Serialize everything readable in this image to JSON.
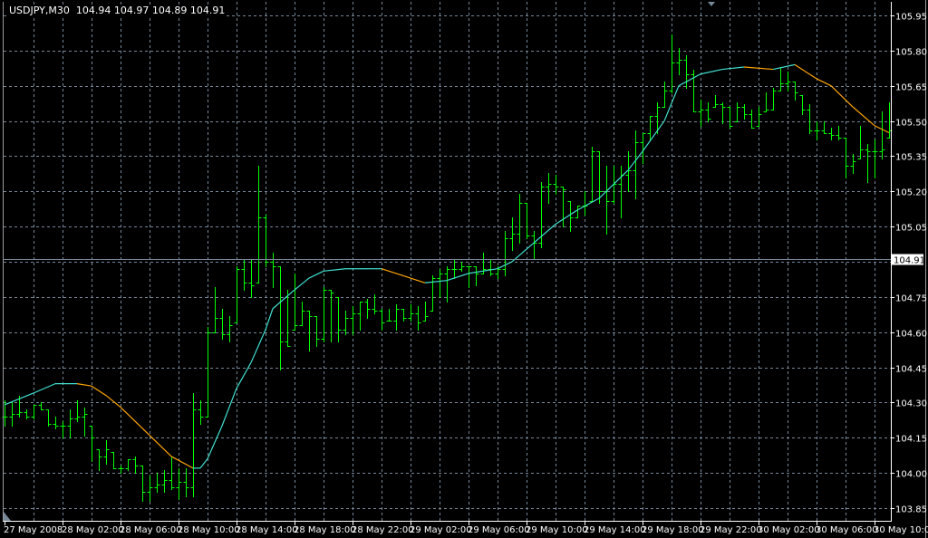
{
  "header": {
    "symbol": "USDJPY,M30",
    "open": "104.94",
    "high": "104.97",
    "low": "104.89",
    "close": "104.91"
  },
  "colors": {
    "background": "#000000",
    "grid": "#778899",
    "bars": "#00FF00",
    "ma_up": "#40E0D0",
    "ma_down": "#FFA500",
    "axis": "#FFFFFF",
    "bid_line": "#778899"
  },
  "chart_data": {
    "type": "ohlc",
    "symbol": "USDJPY",
    "timeframe": "M30",
    "ylim": [
      103.82,
      105.99
    ],
    "grid": true,
    "current_price": "104.91",
    "price_ticks": [
      "105.95",
      "105.80",
      "105.65",
      "105.50",
      "105.35",
      "105.20",
      "105.05",
      "104.90",
      "104.75",
      "104.60",
      "104.45",
      "104.30",
      "104.15",
      "104.00",
      "103.85"
    ],
    "price_tick_labels": [
      "105.95",
      "105.80",
      "105.65",
      "105.50",
      "105.35",
      "105.20",
      "105.05",
      "",
      "104.75",
      "104.60",
      "104.45",
      "104.30",
      "104.15",
      "104.00",
      "103.85"
    ],
    "time_labels": [
      {
        "bar": 0,
        "label": "27 May 2008"
      },
      {
        "bar": 8,
        "label": "28 May 02:00"
      },
      {
        "bar": 16,
        "label": "28 May 06:00"
      },
      {
        "bar": 24,
        "label": "28 May 10:00"
      },
      {
        "bar": 32,
        "label": "28 May 14:00"
      },
      {
        "bar": 40,
        "label": "28 May 18:00"
      },
      {
        "bar": 48,
        "label": "28 May 22:00"
      },
      {
        "bar": 56,
        "label": "29 May 02:00"
      },
      {
        "bar": 64,
        "label": "29 May 06:00"
      },
      {
        "bar": 72,
        "label": "29 May 10:00"
      },
      {
        "bar": 80,
        "label": "29 May 14:00"
      },
      {
        "bar": 88,
        "label": "29 May 18:00"
      },
      {
        "bar": 96,
        "label": "29 May 22:00"
      },
      {
        "bar": 104,
        "label": "30 May 02:00"
      },
      {
        "bar": 112,
        "label": "30 May 06:00"
      },
      {
        "bar": 120,
        "label": "30 May 10:00"
      }
    ],
    "high": [
      104.31,
      104.3,
      104.33,
      104.27,
      104.29,
      104.3,
      104.27,
      104.24,
      104.22,
      104.27,
      104.31,
      104.28,
      104.2,
      104.1,
      104.14,
      104.09,
      104.03,
      104.06,
      104.07,
      104.03,
      103.99,
      104.0,
      104.01,
      104.07,
      104.02,
      104.02,
      104.34,
      104.31,
      104.62,
      104.79,
      104.7,
      104.67,
      104.88,
      104.91,
      104.91,
      105.31,
      105.1,
      104.94,
      104.88,
      104.78,
      104.85,
      104.73,
      104.69,
      104.67,
      104.79,
      104.78,
      104.75,
      104.69,
      104.71,
      104.73,
      104.74,
      104.76,
      104.7,
      104.7,
      104.72,
      104.7,
      104.72,
      104.71,
      104.73,
      104.84,
      104.87,
      104.88,
      104.91,
      104.9,
      104.88,
      104.88,
      104.94,
      104.91,
      104.88,
      105.03,
      105.09,
      105.19,
      105.15,
      105.03,
      105.24,
      105.28,
      105.27,
      105.22,
      105.16,
      105.14,
      105.2,
      105.39,
      105.37,
      105.31,
      105.31,
      105.31,
      105.37,
      105.46,
      105.45,
      105.52,
      105.58,
      105.67,
      105.87,
      105.81,
      105.78,
      105.72,
      105.59,
      105.58,
      105.61,
      105.58,
      105.56,
      105.58,
      105.57,
      105.55,
      105.56,
      105.62,
      105.64,
      105.73,
      105.71,
      105.67,
      105.61,
      105.57,
      105.5,
      105.5,
      105.47,
      105.48,
      105.43,
      105.36,
      105.48,
      105.4,
      105.42,
      105.54,
      105.58
    ],
    "low": [
      104.2,
      104.2,
      104.24,
      104.23,
      104.23,
      104.27,
      104.2,
      104.19,
      104.15,
      104.15,
      104.22,
      104.16,
      104.05,
      104.01,
      104.04,
      104.02,
      104.0,
      104.01,
      104.0,
      103.88,
      103.88,
      103.92,
      103.92,
      103.93,
      103.89,
      103.9,
      103.9,
      104.21,
      104.24,
      104.6,
      104.57,
      104.56,
      104.64,
      104.78,
      104.75,
      104.81,
      104.88,
      104.79,
      104.44,
      104.54,
      104.61,
      104.63,
      104.52,
      104.54,
      104.56,
      104.56,
      104.56,
      104.59,
      104.59,
      104.61,
      104.66,
      104.68,
      104.61,
      104.65,
      104.61,
      104.65,
      104.65,
      104.61,
      104.65,
      104.69,
      104.75,
      104.73,
      104.83,
      104.86,
      104.79,
      104.8,
      104.85,
      104.84,
      104.83,
      104.84,
      104.95,
      104.98,
      105.0,
      104.91,
      104.96,
      105.15,
      105.19,
      105.05,
      105.03,
      105.09,
      105.1,
      105.16,
      105.15,
      105.02,
      105.15,
      105.09,
      105.2,
      105.17,
      105.32,
      105.42,
      105.45,
      105.56,
      105.62,
      105.7,
      105.64,
      105.54,
      105.48,
      105.5,
      105.56,
      105.49,
      105.47,
      105.5,
      105.51,
      105.47,
      105.48,
      105.54,
      105.55,
      105.63,
      105.63,
      105.59,
      105.53,
      105.45,
      105.42,
      105.45,
      105.42,
      105.42,
      105.26,
      105.28,
      105.34,
      105.24,
      105.26,
      105.34,
      105.43
    ],
    "close": [
      104.24,
      104.25,
      104.26,
      104.24,
      104.29,
      104.27,
      104.21,
      104.2,
      104.2,
      104.23,
      104.24,
      104.25,
      104.15,
      104.07,
      104.1,
      104.02,
      104.02,
      104.06,
      104.03,
      103.92,
      103.94,
      103.95,
      103.97,
      103.94,
      103.96,
      103.94,
      104.27,
      104.24,
      104.6,
      104.66,
      104.59,
      104.63,
      104.87,
      104.81,
      104.8,
      105.09,
      104.9,
      104.88,
      104.56,
      104.54,
      104.63,
      104.69,
      104.67,
      104.57,
      104.78,
      104.77,
      104.61,
      104.66,
      104.68,
      104.73,
      104.7,
      104.69,
      104.64,
      104.65,
      104.7,
      104.66,
      104.68,
      104.64,
      104.67,
      104.83,
      104.85,
      104.87,
      104.87,
      104.88,
      104.88,
      104.85,
      104.87,
      104.85,
      104.87,
      105.0,
      105.02,
      105.15,
      105.01,
      104.98,
      105.22,
      105.23,
      105.22,
      105.21,
      105.09,
      105.14,
      105.14,
      105.37,
      105.2,
      105.16,
      105.23,
      105.27,
      105.29,
      105.41,
      105.45,
      105.52,
      105.56,
      105.63,
      105.75,
      105.76,
      105.7,
      105.54,
      105.55,
      105.51,
      105.57,
      105.56,
      105.48,
      105.56,
      105.53,
      105.47,
      105.53,
      105.55,
      105.63,
      105.66,
      105.67,
      105.62,
      105.55,
      105.46,
      105.46,
      105.45,
      105.44,
      105.43,
      105.31,
      105.33,
      105.38,
      105.37,
      105.37,
      105.38,
      105.46
    ],
    "moving_average": [
      [
        0,
        104.29
      ],
      [
        4,
        104.34
      ],
      [
        7,
        104.38
      ],
      [
        10,
        104.38
      ],
      [
        12,
        104.37
      ],
      [
        14,
        104.33
      ],
      [
        16,
        104.28
      ],
      [
        20,
        104.16
      ],
      [
        23,
        104.07
      ],
      [
        26,
        104.02
      ],
      [
        27,
        104.02
      ],
      [
        28,
        104.06
      ],
      [
        30,
        104.2
      ],
      [
        32,
        104.36
      ],
      [
        34,
        104.47
      ],
      [
        36,
        104.61
      ],
      [
        37,
        104.7
      ],
      [
        40,
        104.78
      ],
      [
        42,
        104.83
      ],
      [
        44,
        104.86
      ],
      [
        47,
        104.87
      ],
      [
        50,
        104.87
      ],
      [
        52,
        104.87
      ],
      [
        55,
        104.84
      ],
      [
        58,
        104.81
      ],
      [
        61,
        104.82
      ],
      [
        64,
        104.85
      ],
      [
        68,
        104.87
      ],
      [
        70,
        104.9
      ],
      [
        73,
        104.98
      ],
      [
        76,
        105.06
      ],
      [
        79,
        105.12
      ],
      [
        82,
        105.17
      ],
      [
        86,
        105.29
      ],
      [
        88,
        105.37
      ],
      [
        91,
        105.5
      ],
      [
        93,
        105.65
      ],
      [
        96,
        105.7
      ],
      [
        99,
        105.72
      ],
      [
        102,
        105.73
      ],
      [
        106,
        105.72
      ],
      [
        109,
        105.74
      ],
      [
        112,
        105.68
      ],
      [
        114,
        105.65
      ],
      [
        117,
        105.56
      ],
      [
        120,
        105.48
      ],
      [
        122,
        105.45
      ]
    ]
  }
}
